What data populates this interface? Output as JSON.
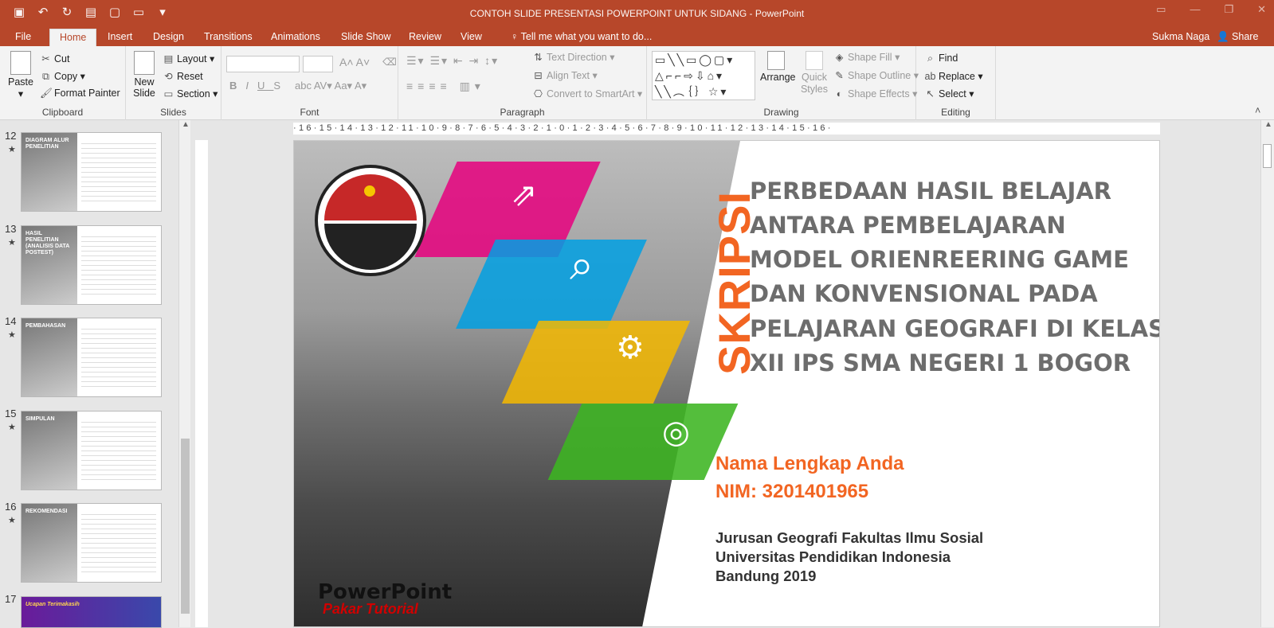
{
  "titlebar": {
    "title": "CONTOH SLIDE PRESENTASI POWERPOINT UNTUK SIDANG - PowerPoint",
    "qat": [
      "save-icon",
      "undo-icon",
      "redo-icon",
      "present-icon",
      "new-icon",
      "open-icon",
      "customize-icon"
    ]
  },
  "tabs": [
    {
      "label": "File"
    },
    {
      "label": "Home"
    },
    {
      "label": "Insert"
    },
    {
      "label": "Design"
    },
    {
      "label": "Transitions"
    },
    {
      "label": "Animations"
    },
    {
      "label": "Slide Show"
    },
    {
      "label": "Review"
    },
    {
      "label": "View"
    }
  ],
  "tellme": "Tell me what you want to do...",
  "user": "Sukma Naga",
  "share": "Share",
  "clipboard": {
    "paste": "Paste",
    "cut": "Cut",
    "copy": "Copy",
    "format_painter": "Format Painter",
    "label": "Clipboard"
  },
  "slides_grp": {
    "new_slide": "New Slide",
    "layout": "Layout",
    "reset": "Reset",
    "section": "Section",
    "label": "Slides"
  },
  "font_grp": {
    "label": "Font"
  },
  "paragraph": {
    "text_direction": "Text Direction",
    "align_text": "Align Text",
    "smartart": "Convert to SmartArt",
    "label": "Paragraph"
  },
  "drawing": {
    "arrange": "Arrange",
    "quick_styles": "Quick Styles",
    "shape_fill": "Shape Fill",
    "shape_outline": "Shape Outline",
    "shape_effects": "Shape Effects",
    "label": "Drawing"
  },
  "editing": {
    "find": "Find",
    "replace": "Replace",
    "select": "Select",
    "label": "Editing"
  },
  "thumbnails": [
    {
      "num": "12",
      "title": "DIAGRAM ALUR PENELITIAN"
    },
    {
      "num": "13",
      "title": "HASIL PENELITIAN (ANALISIS DATA POSTEST)"
    },
    {
      "num": "14",
      "title": "PEMBAHASAN"
    },
    {
      "num": "15",
      "title": "SIMPULAN"
    },
    {
      "num": "16",
      "title": "REKOMENDASI"
    },
    {
      "num": "17",
      "title": "Ucapan Terimakasih"
    }
  ],
  "ruler": "·16·15·14·13·12·11·10·9·8·7·6·5·4·3·2·1·0·1·2·3·4·5·6·7·8·9·10·11·12·13·14·15·16·",
  "slide": {
    "skripsi": "SKRIPSI",
    "title_lines": [
      "PERBEDAAN HASIL BELAJAR",
      "ANTARA PEMBELAJARAN",
      "MODEL ORIENREERING GAME",
      "DAN KONVENSIONAL PADA",
      "PELAJARAN GEOGRAFI DI KELAS",
      "XII IPS SMA  NEGERI 1 BOGOR"
    ],
    "name": "Nama Lengkap Anda",
    "nim": "NIM: 3201401965",
    "inst_lines": [
      "Jurusan Geografi  Fakultas Ilmu Sosial",
      "Universitas Pendidikan Indonesia",
      "Bandung 2019"
    ],
    "pp_logo": "PowerPoint",
    "pp_tag": "Pakar Tutorial",
    "colors": {
      "magenta": "#e6007e",
      "cyan": "#00a0e3",
      "yellow": "#f5b800",
      "green": "#3cb521",
      "orange": "#f26522"
    }
  }
}
